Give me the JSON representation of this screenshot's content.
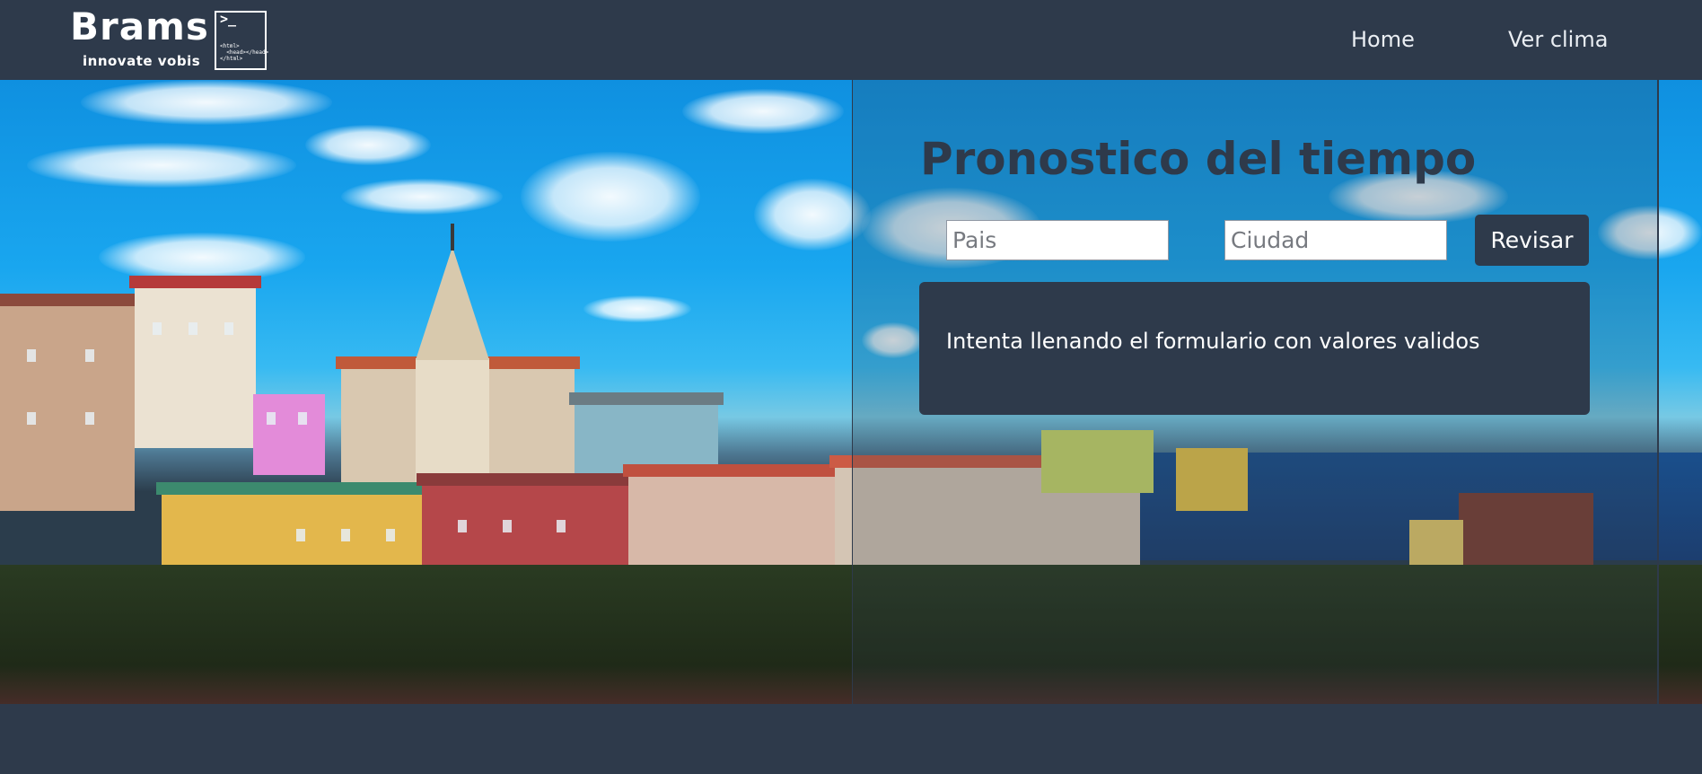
{
  "brand": {
    "name": "Brams",
    "tagline": "innovate vobis",
    "prompt_glyph": ">_",
    "code_lines": [
      "<html>",
      "  <head></head>",
      "</html>"
    ]
  },
  "nav": {
    "items": [
      {
        "label": "Home"
      },
      {
        "label": "Ver clima"
      }
    ]
  },
  "forecast": {
    "title": "Pronostico del tiempo",
    "country_placeholder": "Pais",
    "country_value": "",
    "city_placeholder": "Ciudad",
    "city_value": "",
    "submit_label": "Revisar",
    "message": "Intenta llenando el formulario con valores validos"
  },
  "hero": {
    "icon": "city-hillside-photo"
  },
  "colors": {
    "navbar": "#2e3a4b",
    "card": "#2e3a4b",
    "title": "#2e3a4b",
    "text_light": "#ffffff"
  }
}
